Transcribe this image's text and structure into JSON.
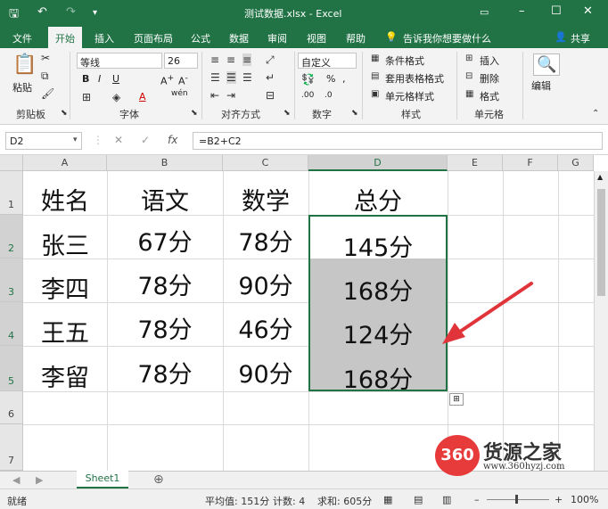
{
  "window": {
    "title": "测试数据.xlsx - Excel"
  },
  "menu": {
    "tabs": [
      "文件",
      "开始",
      "插入",
      "页面布局",
      "公式",
      "数据",
      "审阅",
      "视图",
      "帮助"
    ],
    "tell_me": "告诉我你想要做什么",
    "share": "共享"
  },
  "ribbon": {
    "paste": "粘贴",
    "font_name": "等线",
    "font_size": "26",
    "number_format": "自定义",
    "conditional": "条件格式",
    "table_format": "套用表格格式",
    "cell_style": "单元格样式",
    "insert": "插入",
    "delete": "删除",
    "format": "格式",
    "edit": "编辑",
    "groups": [
      "剪贴板",
      "字体",
      "对齐方式",
      "数字",
      "样式",
      "单元格"
    ]
  },
  "formula_bar": {
    "name_box": "D2",
    "formula": "=B2+C2",
    "fx": "fx"
  },
  "sheet": {
    "columns": [
      "A",
      "B",
      "C",
      "D",
      "E",
      "F",
      "G"
    ],
    "rows": [
      "1",
      "2",
      "3",
      "4",
      "5",
      "6",
      "7"
    ],
    "cells": [
      [
        "姓名",
        "语文",
        "数学",
        "总分"
      ],
      [
        "张三",
        "67分",
        "78分",
        "145分"
      ],
      [
        "李四",
        "78分",
        "90分",
        "168分"
      ],
      [
        "王五",
        "78分",
        "46分",
        "124分"
      ],
      [
        "李留",
        "78分",
        "90分",
        "168分"
      ]
    ]
  },
  "tabs": {
    "sheet1": "Sheet1"
  },
  "status": {
    "ready": "就绪",
    "average": "平均值: 151分",
    "count": "计数: 4",
    "sum": "求和: 605分",
    "zoom": "100%"
  },
  "watermark": {
    "brand": "360",
    "name": "货源之家",
    "url": "www.360hyzj.com"
  },
  "colors": {
    "accent": "#217346",
    "arrow": "#e0343a"
  }
}
